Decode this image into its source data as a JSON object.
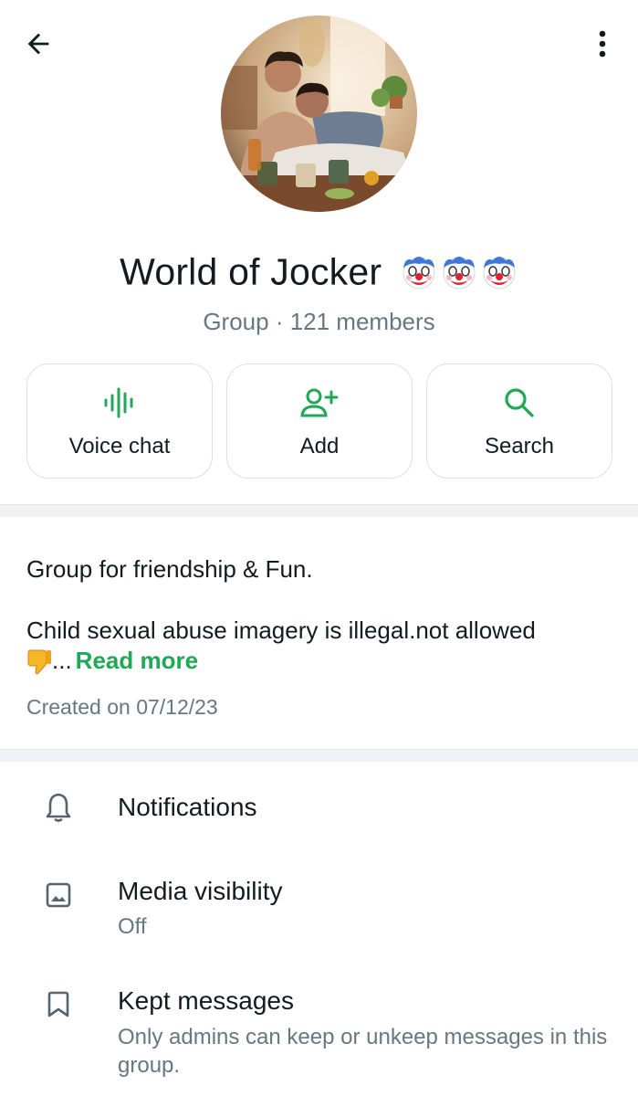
{
  "header": {
    "back_icon": "arrow-left-icon",
    "menu_icon": "more-vert-icon"
  },
  "group": {
    "name": "World of Jocker",
    "name_emoji": [
      "clown-face",
      "clown-face",
      "clown-face"
    ],
    "meta": "Group · 121 members"
  },
  "actions": [
    {
      "label": "Voice chat",
      "icon": "voice-wave-icon"
    },
    {
      "label": "Add",
      "icon": "add-person-icon"
    },
    {
      "label": "Search",
      "icon": "search-icon"
    }
  ],
  "description": {
    "line1": "Group for friendship & Fun.",
    "line2": "Child sexual abuse imagery is illegal.not allowed",
    "ellipsis": "...",
    "read_more": "Read more",
    "created": "Created on 07/12/23"
  },
  "settings": [
    {
      "title": "Notifications",
      "icon": "bell-icon"
    },
    {
      "title": "Media visibility",
      "subtitle": "Off",
      "icon": "image-icon"
    },
    {
      "title": "Kept messages",
      "subtitle": "Only admins can keep or unkeep messages in this group.",
      "icon": "bookmark-icon"
    }
  ],
  "colors": {
    "accent_green": "#1fa855",
    "text_primary": "#111b21",
    "text_secondary": "#667781",
    "divider": "#f0f2f5"
  }
}
